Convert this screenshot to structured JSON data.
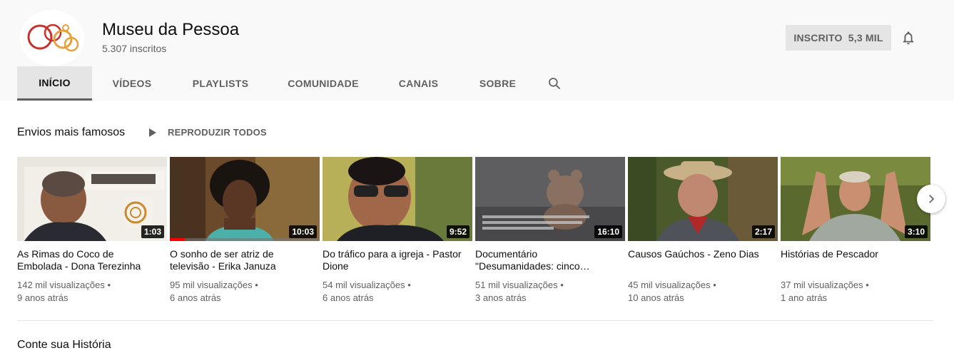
{
  "channel": {
    "name": "Museu da Pessoa",
    "subscribers": "5.307 inscritos",
    "subscribe_label": "INSCRITO  5,3 MIL",
    "logo_icon": "museu-da-pessoa-logo",
    "colors": {
      "logo_red": "#c9302c",
      "logo_orange": "#e8a13a",
      "progress_red": "#ff0000"
    }
  },
  "tabs": [
    {
      "label": "INÍCIO",
      "active": true
    },
    {
      "label": "VÍDEOS",
      "active": false
    },
    {
      "label": "PLAYLISTS",
      "active": false
    },
    {
      "label": "COMUNIDADE",
      "active": false
    },
    {
      "label": "CANAIS",
      "active": false
    },
    {
      "label": "SOBRE",
      "active": false
    }
  ],
  "shelf": {
    "title": "Envios mais famosos",
    "play_all": "REPRODUZIR TODOS",
    "videos": [
      {
        "title": "As Rimas do Coco de Embolada - Dona Terezinha",
        "duration": "1:03",
        "views": "142 mil visualizações •",
        "age": "9 anos atrás",
        "watched_fraction": 0
      },
      {
        "title": "O sonho de ser atriz de televisão - Erika Januza",
        "duration": "10:03",
        "views": "95 mil visualizações •",
        "age": "6 anos atrás",
        "watched_fraction": 0.1
      },
      {
        "title": "Do tráfico para a igreja - Pastor Dione",
        "duration": "9:52",
        "views": "54 mil visualizações •",
        "age": "6 anos atrás",
        "watched_fraction": 0
      },
      {
        "title": "Documentário \"Desumanidades: cinco…",
        "duration": "16:10",
        "views": "51 mil visualizações •",
        "age": "3 anos atrás",
        "watched_fraction": 0
      },
      {
        "title": "Causos Gaúchos - Zeno Dias",
        "duration": "2:17",
        "views": "45 mil visualizações •",
        "age": "10 anos atrás",
        "watched_fraction": 0
      },
      {
        "title": "Histórias de Pescador",
        "duration": "3:10",
        "views": "37 mil visualizações •",
        "age": "1 ano atrás",
        "watched_fraction": 0
      }
    ]
  },
  "section2": {
    "title": "Conte sua História"
  }
}
